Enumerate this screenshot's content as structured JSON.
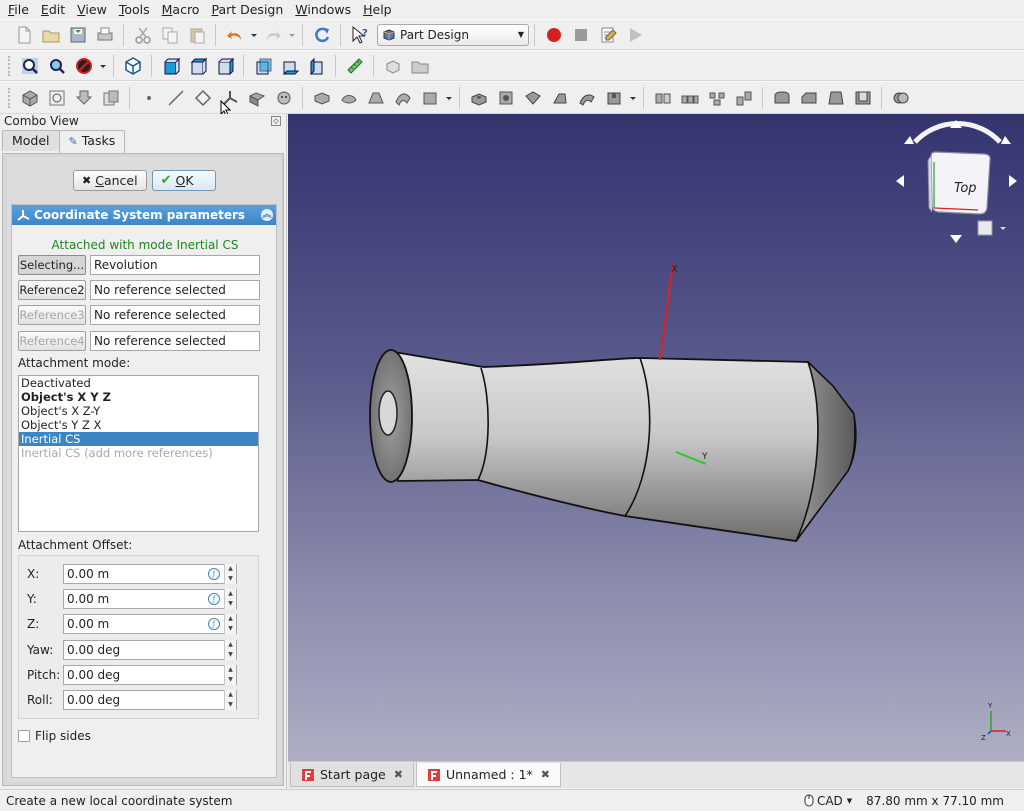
{
  "menu": {
    "items": [
      {
        "u": "F",
        "rest": "ile"
      },
      {
        "u": "E",
        "rest": "dit"
      },
      {
        "u": "V",
        "rest": "iew"
      },
      {
        "u": "T",
        "rest": "ools"
      },
      {
        "u": "M",
        "rest": "acro"
      },
      {
        "u": "P",
        "rest": "art Design"
      },
      {
        "u": "W",
        "rest": "indows"
      },
      {
        "u": "H",
        "rest": "elp"
      }
    ]
  },
  "toolbar": {
    "workbench": "Part Design"
  },
  "combo": {
    "title": "Combo View",
    "tabs": [
      "Model",
      "Tasks"
    ]
  },
  "task": {
    "cancel_u": "C",
    "cancel_rest": "ancel",
    "ok_u": "O",
    "ok_rest": "K",
    "section_title": "Coordinate System parameters",
    "attached_status": "Attached with mode Inertial CS",
    "references": [
      {
        "button": "Selecting...",
        "value": "Revolution",
        "state": "selecting"
      },
      {
        "button": "Reference2",
        "value": "No reference selected",
        "state": "enabled"
      },
      {
        "button": "Reference3",
        "value": "No reference selected",
        "state": "disabled"
      },
      {
        "button": "Reference4",
        "value": "No reference selected",
        "state": "disabled"
      }
    ],
    "attachment_mode_label": "Attachment mode:",
    "modes": [
      {
        "label": "Deactivated",
        "style": "normal"
      },
      {
        "label": "Object's  X Y Z",
        "style": "bold"
      },
      {
        "label": "Object's  X Z-Y",
        "style": "normal"
      },
      {
        "label": "Object's  Y Z X",
        "style": "normal"
      },
      {
        "label": "Inertial CS",
        "style": "selected"
      },
      {
        "label": "Inertial CS (add more references)",
        "style": "disabled"
      }
    ],
    "offset_label": "Attachment Offset:",
    "offsets": [
      {
        "label": "X:",
        "value": "0.00 m",
        "expr": true
      },
      {
        "label": "Y:",
        "value": "0.00 m",
        "expr": true
      },
      {
        "label": "Z:",
        "value": "0.00 m",
        "expr": true
      },
      {
        "label": "Yaw:",
        "value": "0.00 deg",
        "expr": false
      },
      {
        "label": "Pitch:",
        "value": "0.00 deg",
        "expr": false
      },
      {
        "label": "Roll:",
        "value": "0.00 deg",
        "expr": false
      }
    ],
    "flip_label": "Flip sides"
  },
  "view": {
    "navcube_face": "Top",
    "axis_x": "X",
    "axis_y": "Y",
    "mini_axis_y": "Y",
    "mini_axis_x": "X",
    "mini_axis_z": "Z"
  },
  "doc_tabs": [
    {
      "label": "Start page",
      "active": false
    },
    {
      "label": "Unnamed : 1*",
      "active": true
    }
  ],
  "status": {
    "message": "Create a new local coordinate system",
    "nav_style": "CAD",
    "dimensions": "87.80 mm x 77.10 mm"
  },
  "colors": {
    "accent": "#3d86c8",
    "status_green": "#1a8a1a",
    "record_red": "#d62020"
  }
}
